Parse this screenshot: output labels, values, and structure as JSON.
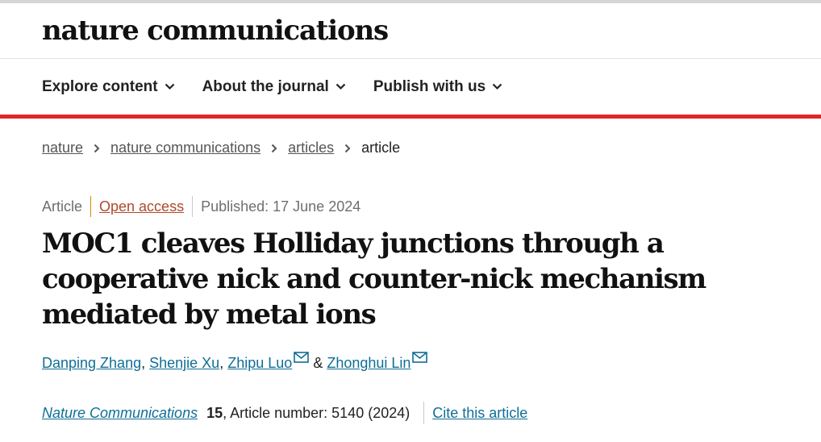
{
  "site": {
    "logo": "nature communications"
  },
  "nav": {
    "items": [
      {
        "label": "Explore content"
      },
      {
        "label": "About the journal"
      },
      {
        "label": "Publish with us"
      }
    ]
  },
  "breadcrumb": {
    "items": [
      "nature",
      "nature communications",
      "articles"
    ],
    "current": "article"
  },
  "article": {
    "type": "Article",
    "access": "Open access",
    "published": "Published: 17 June 2024",
    "title": "MOC1 cleaves Holliday junctions through a cooperative nick and counter-nick mechanism mediated by metal ions",
    "authors": [
      {
        "name": "Danping Zhang",
        "suffix": ","
      },
      {
        "name": "Shenjie Xu",
        "suffix": ","
      },
      {
        "name": "Zhipu Luo",
        "suffix": ""
      },
      {
        "name": "Zhonghui Lin",
        "suffix": ""
      }
    ],
    "author_joiner": "&",
    "journal": "Nature Communications",
    "volume": "15",
    "article_number": ", Article number: 5140 (2024)",
    "cite_label": "Cite this article"
  },
  "icons": {
    "nav_chevron": "chevron-down-icon",
    "breadcrumb_separator": "chevron-right-icon",
    "author_contact": "mail-icon"
  },
  "colors": {
    "accent_red": "#e0262b",
    "link_blue": "#0f6e96",
    "open_access": "#b04a2c"
  }
}
